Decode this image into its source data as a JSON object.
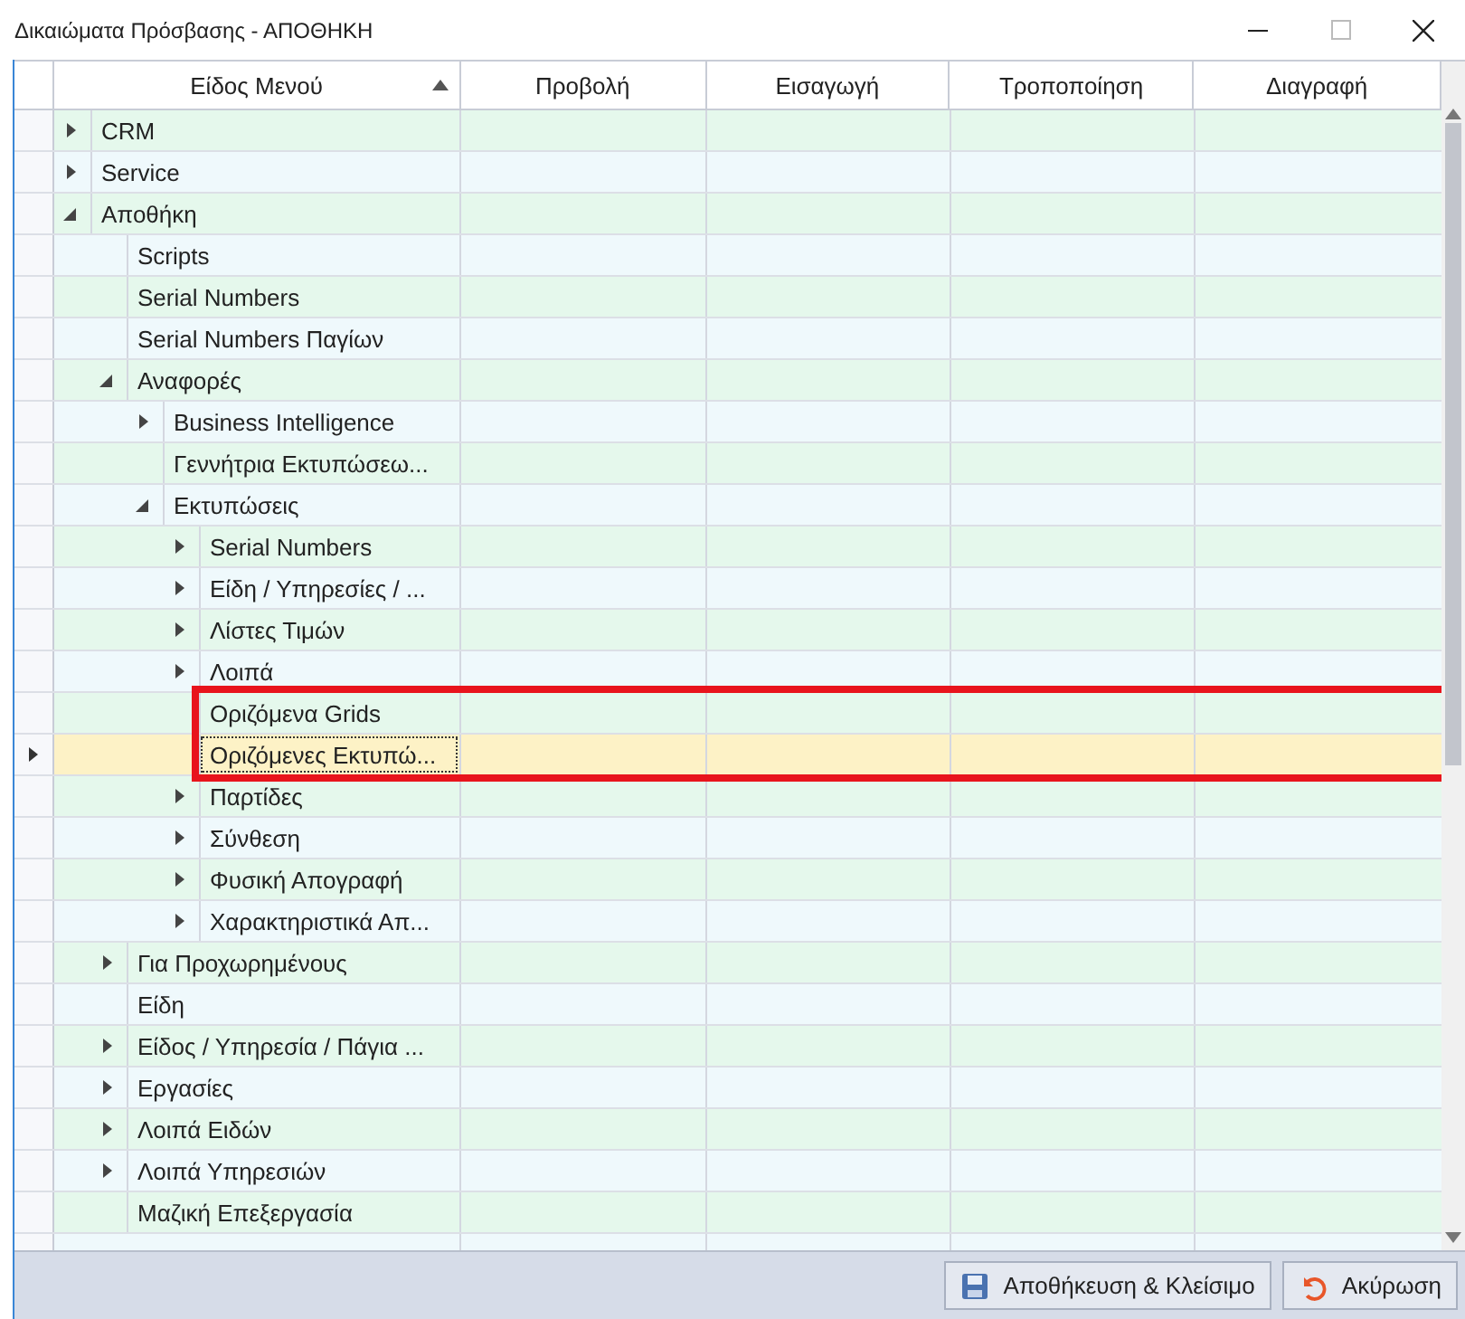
{
  "window": {
    "title": "Δικαιώματα Πρόσβασης - ΑΠΟΘΗΚΗ"
  },
  "table": {
    "columns": [
      {
        "label": "Είδος Μενού",
        "sorted": true
      },
      {
        "label": "Προβολή",
        "sorted": false
      },
      {
        "label": "Εισαγωγή",
        "sorted": false
      },
      {
        "label": "Τροποποίηση",
        "sorted": false
      },
      {
        "label": "Διαγραφή",
        "sorted": false
      }
    ],
    "rows": [
      {
        "label": "CRM",
        "expanded": false,
        "selected": false,
        "highlighted": false
      },
      {
        "label": "Service",
        "expanded": false,
        "selected": false,
        "highlighted": false
      },
      {
        "label": "Αποθήκη",
        "expanded": true,
        "selected": false,
        "highlighted": false,
        "children": [
          {
            "label": "Scripts",
            "selected": false,
            "highlighted": false
          },
          {
            "label": "Serial Numbers",
            "selected": false,
            "highlighted": false
          },
          {
            "label": "Serial Numbers Παγίων",
            "selected": false,
            "highlighted": false
          },
          {
            "label": "Αναφορές",
            "expanded": true,
            "selected": false,
            "highlighted": false,
            "children": [
              {
                "label": "Business Intelligence",
                "expanded": false,
                "selected": false,
                "highlighted": false
              },
              {
                "label": "Γεννήτρια Εκτυπώσεω...",
                "selected": false,
                "highlighted": false
              },
              {
                "label": "Εκτυπώσεις",
                "expanded": true,
                "selected": false,
                "highlighted": false,
                "children": [
                  {
                    "label": "Serial Numbers",
                    "expanded": false,
                    "selected": false,
                    "highlighted": false
                  },
                  {
                    "label": "Είδη / Υπηρεσίες / ...",
                    "expanded": false,
                    "selected": false,
                    "highlighted": false
                  },
                  {
                    "label": "Λίστες Τιμών",
                    "expanded": false,
                    "selected": false,
                    "highlighted": false
                  },
                  {
                    "label": "Λοιπά",
                    "expanded": false,
                    "selected": false,
                    "highlighted": false
                  },
                  {
                    "label": "Οριζόμενα Grids",
                    "selected": false,
                    "highlighted": true
                  },
                  {
                    "label": "Οριζόμενες Εκτυπώ...",
                    "selected": true,
                    "highlighted": true
                  },
                  {
                    "label": "Παρτίδες",
                    "expanded": false,
                    "selected": false,
                    "highlighted": false
                  },
                  {
                    "label": "Σύνθεση",
                    "expanded": false,
                    "selected": false,
                    "highlighted": false
                  },
                  {
                    "label": "Φυσική Απογραφή",
                    "expanded": false,
                    "selected": false,
                    "highlighted": false
                  },
                  {
                    "label": "Χαρακτηριστικά Απ...",
                    "expanded": false,
                    "selected": false,
                    "highlighted": false
                  }
                ]
              }
            ]
          },
          {
            "label": "Για Προχωρημένους",
            "expanded": false,
            "selected": false,
            "highlighted": false
          },
          {
            "label": "Είδη",
            "selected": false,
            "highlighted": false
          },
          {
            "label": "Είδος / Υπηρεσία / Πάγια ...",
            "expanded": false,
            "selected": false,
            "highlighted": false
          },
          {
            "label": "Εργασίες",
            "expanded": false,
            "selected": false,
            "highlighted": false
          },
          {
            "label": "Λοιπά Ειδών",
            "expanded": false,
            "selected": false,
            "highlighted": false
          },
          {
            "label": "Λοιπά Υπηρεσιών",
            "expanded": false,
            "selected": false,
            "highlighted": false
          },
          {
            "label": "Μαζική Επεξεργασία",
            "selected": false,
            "highlighted": false
          }
        ]
      }
    ]
  },
  "buttons": [
    {
      "kind": "save",
      "label": "Αποθήκευση & Κλείσιμο"
    },
    {
      "kind": "cancel",
      "label": "Ακύρωση"
    }
  ]
}
